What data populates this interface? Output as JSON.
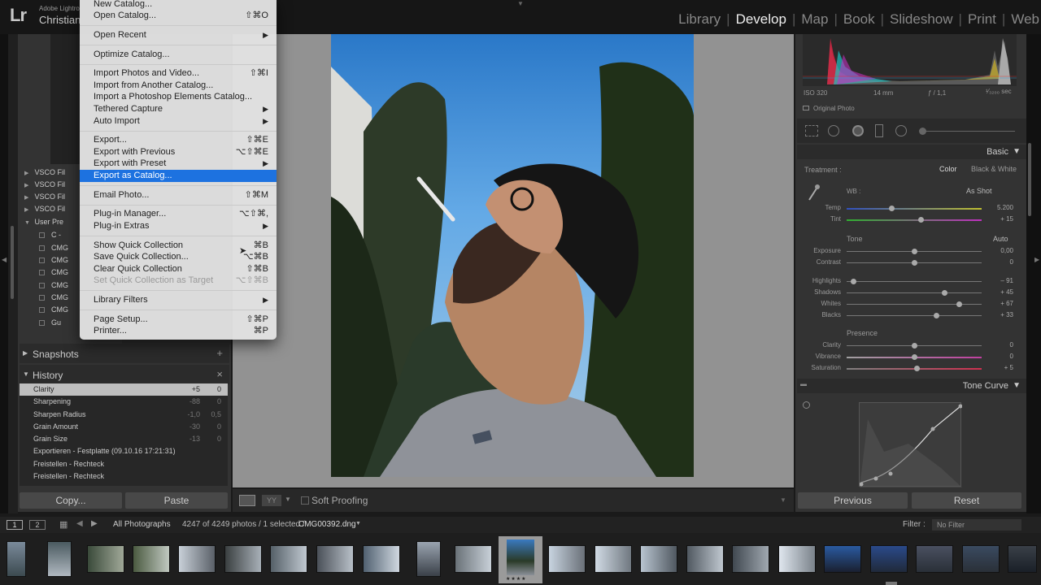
{
  "header": {
    "app_small": "Adobe Lightro",
    "user": "Christian",
    "logo": "Lr"
  },
  "modules": [
    {
      "label": "Library"
    },
    {
      "label": "Develop",
      "active": true
    },
    {
      "label": "Map"
    },
    {
      "label": "Book"
    },
    {
      "label": "Slideshow"
    },
    {
      "label": "Print"
    },
    {
      "label": "Web"
    }
  ],
  "menu": {
    "items": [
      {
        "label": "New Catalog...",
        "shortcut": ""
      },
      {
        "label": "Open Catalog...",
        "shortcut": "⇧⌘O"
      },
      {
        "label": "Open Recent",
        "submenu": true
      },
      {
        "label": "Optimize Catalog..."
      },
      {
        "label": "Import Photos and Video...",
        "shortcut": "⇧⌘I"
      },
      {
        "label": "Import from Another Catalog..."
      },
      {
        "label": "Import a Photoshop Elements Catalog..."
      },
      {
        "label": "Tethered Capture",
        "submenu": true
      },
      {
        "label": "Auto Import",
        "submenu": true
      },
      {
        "label": "Export...",
        "shortcut": "⇧⌘E"
      },
      {
        "label": "Export with Previous",
        "shortcut": "⌥⇧⌘E"
      },
      {
        "label": "Export with Preset",
        "submenu": true
      },
      {
        "label": "Export as Catalog...",
        "highlighted": true
      },
      {
        "label": "Email Photo...",
        "shortcut": "⇧⌘M"
      },
      {
        "label": "Plug-in Manager...",
        "shortcut": "⌥⇧⌘,"
      },
      {
        "label": "Plug-in Extras",
        "submenu": true
      },
      {
        "label": "Show Quick Collection",
        "shortcut": "⌘B"
      },
      {
        "label": "Save Quick Collection...",
        "shortcut": "⌥⌘B"
      },
      {
        "label": "Clear Quick Collection",
        "shortcut": "⇧⌘B"
      },
      {
        "label": "Set Quick Collection as Target",
        "shortcut": "⌥⇧⌘B",
        "disabled": true
      },
      {
        "label": "Library Filters",
        "submenu": true
      },
      {
        "label": "Page Setup...",
        "shortcut": "⇧⌘P"
      },
      {
        "label": "Printer...",
        "shortcut": "⌘P"
      }
    ]
  },
  "presets": {
    "folders": [
      "VSCO Fil",
      "VSCO Fil",
      "VSCO Fil",
      "VSCO Fil",
      "User Pre"
    ],
    "items": [
      "C -",
      "CMG",
      "CMG",
      "CMG",
      "CMG",
      "CMG",
      "CMG",
      "Gu"
    ]
  },
  "snapshots": {
    "title": "Snapshots",
    "action": "+"
  },
  "history": {
    "title": "History",
    "action": "×",
    "rows": [
      {
        "label": "Clarity",
        "v1": "+5",
        "v2": "0",
        "selected": true
      },
      {
        "label": "Sharpening",
        "v1": "-88",
        "v2": "0"
      },
      {
        "label": "Sharpen Radius",
        "v1": "-1,0",
        "v2": "0,5"
      },
      {
        "label": "Grain Amount",
        "v1": "-30",
        "v2": "0"
      },
      {
        "label": "Grain Size",
        "v1": "-13",
        "v2": "0"
      },
      {
        "label": "Exportieren - Festplatte (09.10.16 17:21:31)",
        "v1": "",
        "v2": ""
      },
      {
        "label": "Freistellen - Rechteck",
        "v1": "",
        "v2": ""
      },
      {
        "label": "Freistellen - Rechteck",
        "v1": "",
        "v2": ""
      }
    ]
  },
  "left_buttons": {
    "copy": "Copy...",
    "paste": "Paste"
  },
  "center_toolbar": {
    "soft_proofing": "Soft Proofing"
  },
  "histogram": {
    "iso": "ISO 320",
    "focal": "14 mm",
    "aperture": "ƒ / 1,1",
    "shutter": "¹⁄₃₂₀₀ sec",
    "original": "Original Photo"
  },
  "basic": {
    "title": "Basic",
    "treatment_label": "Treatment :",
    "color": "Color",
    "bw": "Black & White",
    "wb_label": "WB :",
    "wb_value": "As Shot",
    "tone_label": "Tone",
    "auto": "Auto",
    "presence_label": "Presence",
    "sliders": [
      {
        "label": "Temp",
        "value": "5.200",
        "pos": 0.33
      },
      {
        "label": "Tint",
        "value": "+ 15",
        "pos": 0.55
      },
      {
        "label": "Exposure",
        "value": "0,00",
        "pos": 0.5
      },
      {
        "label": "Contrast",
        "value": "0",
        "pos": 0.5
      },
      {
        "label": "Highlights",
        "value": "– 91",
        "pos": 0.05
      },
      {
        "label": "Shadows",
        "value": "+ 45",
        "pos": 0.72
      },
      {
        "label": "Whites",
        "value": "+ 67",
        "pos": 0.83
      },
      {
        "label": "Blacks",
        "value": "+ 33",
        "pos": 0.66
      },
      {
        "label": "Clarity",
        "value": "0",
        "pos": 0.5
      },
      {
        "label": "Vibrance",
        "value": "0",
        "pos": 0.5
      },
      {
        "label": "Saturation",
        "value": "+ 5",
        "pos": 0.52
      }
    ]
  },
  "tone_curve": {
    "title": "Tone Curve"
  },
  "right_buttons": {
    "previous": "Previous",
    "reset": "Reset"
  },
  "filmstrip": {
    "page1": "1",
    "page2": "2",
    "source": "All Photographs",
    "count": "4247 of 4249 photos / 1 selected /",
    "filename": "CMG00392.dng",
    "filter_label": "Filter :",
    "filter_value": "No Filter"
  },
  "colors": {
    "highlight": "#1d72e0",
    "panel": "#333333",
    "active_module": "#eeeeee"
  }
}
